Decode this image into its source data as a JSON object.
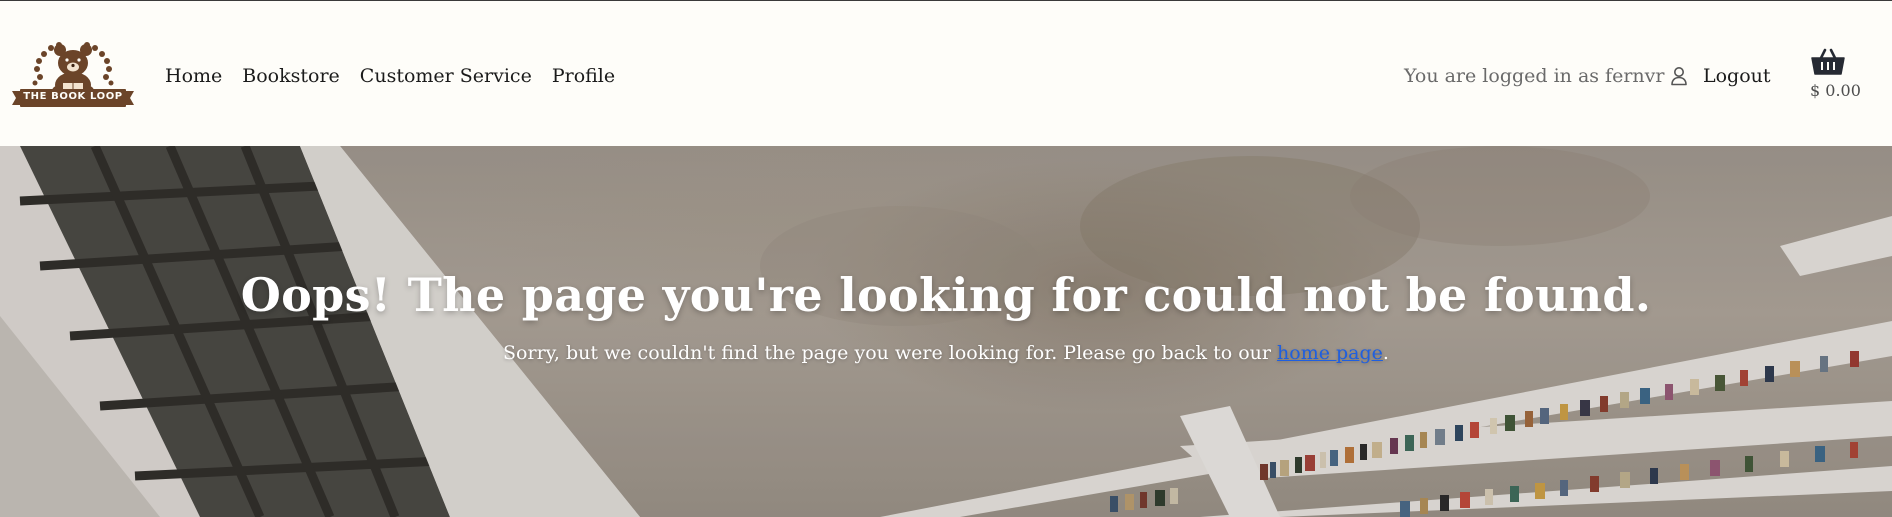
{
  "brand": {
    "logo_text": "THE BOOK LOOP"
  },
  "nav": {
    "items": [
      {
        "label": "Home"
      },
      {
        "label": "Bookstore"
      },
      {
        "label": "Customer Service"
      },
      {
        "label": "Profile"
      }
    ]
  },
  "account": {
    "status_text": "You are logged in as fernvr",
    "icon": "user-icon",
    "logout_label": "Logout"
  },
  "cart": {
    "icon": "basket-icon",
    "total": "$ 0.00"
  },
  "error": {
    "title": "Oops! The page you're looking for could not be found.",
    "message": "Sorry, but we couldn't find the page you were looking for. Please go back to our",
    "link_text": "home page",
    "message_end": "."
  },
  "colors": {
    "header_bg": "#fefdf9",
    "brand_brown": "#6b4429",
    "link_blue": "#1f5fe0",
    "text_dark": "#1b1b1b",
    "text_muted": "#6a6a6a"
  }
}
